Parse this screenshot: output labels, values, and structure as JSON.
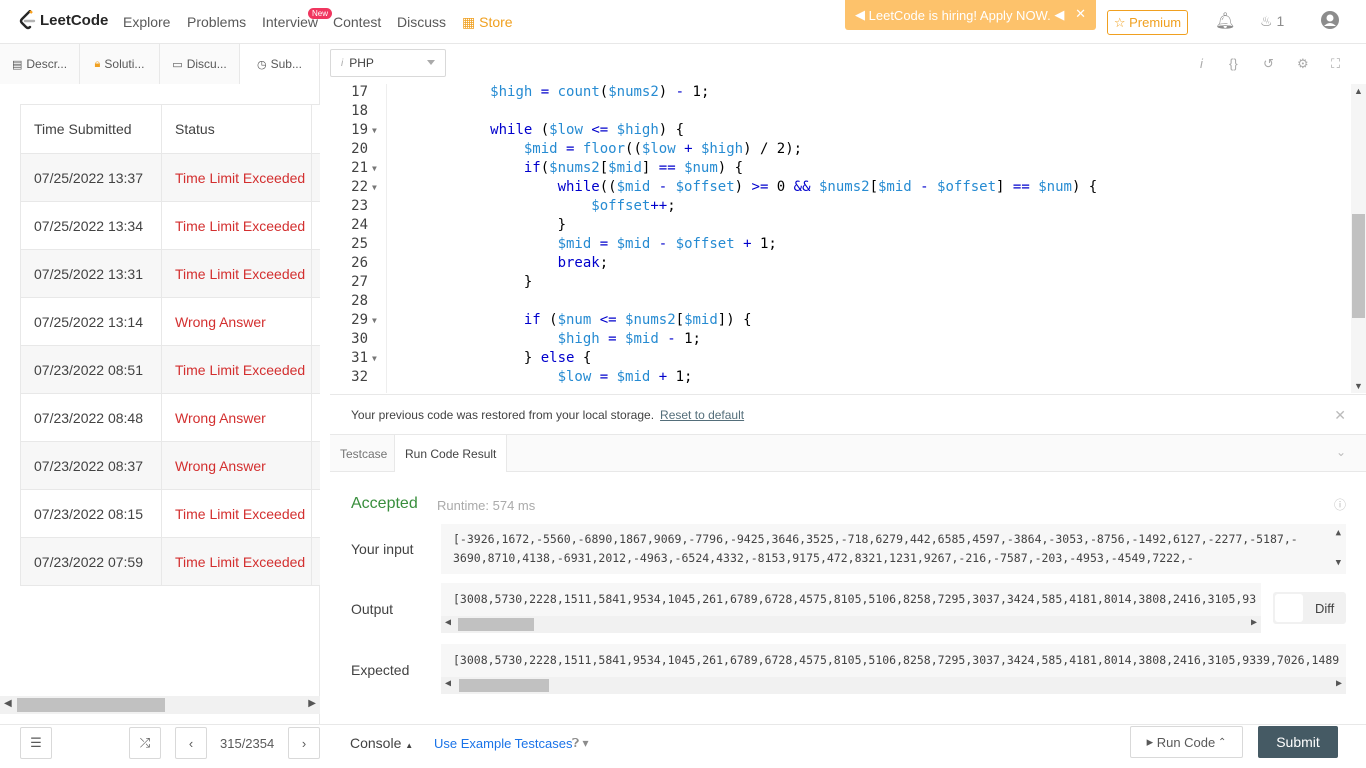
{
  "nav": {
    "logo": "LeetCode",
    "links": [
      "Explore",
      "Problems",
      "Interview",
      "Contest",
      "Discuss",
      "Store"
    ],
    "new_badge": "New",
    "hiring": "LeetCode is hiring! Apply NOW.",
    "premium": "Premium",
    "coins": "1"
  },
  "left": {
    "tabs": [
      "Descr...",
      "Soluti...",
      "Discu...",
      "Sub..."
    ],
    "table_headers": [
      "Time Submitted",
      "Status"
    ],
    "rows": [
      {
        "time": "07/25/2022 13:37",
        "status": "Time Limit Exceeded"
      },
      {
        "time": "07/25/2022 13:34",
        "status": "Time Limit Exceeded"
      },
      {
        "time": "07/25/2022 13:31",
        "status": "Time Limit Exceeded"
      },
      {
        "time": "07/25/2022 13:14",
        "status": "Wrong Answer"
      },
      {
        "time": "07/23/2022 08:51",
        "status": "Time Limit Exceeded"
      },
      {
        "time": "07/23/2022 08:48",
        "status": "Wrong Answer"
      },
      {
        "time": "07/23/2022 08:37",
        "status": "Wrong Answer"
      },
      {
        "time": "07/23/2022 08:15",
        "status": "Time Limit Exceeded"
      },
      {
        "time": "07/23/2022 07:59",
        "status": "Time Limit Exceeded"
      }
    ]
  },
  "editor": {
    "language": "PHP",
    "lines": [
      {
        "n": "17",
        "fold": false,
        "t": "            $high = count($nums2) - 1;"
      },
      {
        "n": "18",
        "fold": false,
        "t": ""
      },
      {
        "n": "19",
        "fold": true,
        "t": "            while ($low <= $high) {"
      },
      {
        "n": "20",
        "fold": false,
        "t": "                $mid = floor(($low + $high) / 2);"
      },
      {
        "n": "21",
        "fold": true,
        "t": "                if($nums2[$mid] == $num) {"
      },
      {
        "n": "22",
        "fold": true,
        "t": "                    while(($mid - $offset) >= 0 && $nums2[$mid - $offset] == $num) {"
      },
      {
        "n": "23",
        "fold": false,
        "t": "                        $offset++;"
      },
      {
        "n": "24",
        "fold": false,
        "t": "                    }"
      },
      {
        "n": "25",
        "fold": false,
        "t": "                    $mid = $mid - $offset + 1;"
      },
      {
        "n": "26",
        "fold": false,
        "t": "                    break;"
      },
      {
        "n": "27",
        "fold": false,
        "t": "                }"
      },
      {
        "n": "28",
        "fold": false,
        "t": ""
      },
      {
        "n": "29",
        "fold": true,
        "t": "                if ($num <= $nums2[$mid]) {"
      },
      {
        "n": "30",
        "fold": false,
        "t": "                    $high = $mid - 1;"
      },
      {
        "n": "31",
        "fold": true,
        "t": "                } else {"
      },
      {
        "n": "32",
        "fold": false,
        "t": "                    $low = $mid + 1;"
      }
    ]
  },
  "restore": {
    "text": "Your previous code was restored from your local storage.",
    "link": "Reset to default"
  },
  "result_tabs": [
    "Testcase",
    "Run Code Result"
  ],
  "result": {
    "status": "Accepted",
    "runtime": "Runtime: 574 ms",
    "input_label": "Your input",
    "input_line1": "[-3926,1672,-5560,-6890,1867,9069,-7796,-9425,3646,3525,-718,6279,442,6585,4597,-3864,-3053,-8756,-1492,6127,-2277,-5187,-",
    "input_line2": "3690,8710,4138,-6931,2012,-4963,-6524,4332,-8153,9175,472,8321,1231,9267,-216,-7587,-203,-4953,-4549,7222,-",
    "output_label": "Output",
    "output": "[3008,5730,2228,1511,5841,9534,1045,261,6789,6728,4575,8105,5106,8258,7295,3037,3424,585,4181,8014,3808,2416,3105,93",
    "expected_label": "Expected",
    "expected": "[3008,5730,2228,1511,5841,9534,1045,261,6789,6728,4575,8105,5106,8258,7295,3037,3424,585,4181,8014,3808,2416,3105,9339,7026,1489",
    "diff": "Diff"
  },
  "bottom": {
    "pager": "315/2354",
    "console": "Console",
    "example": "Use Example Testcases",
    "run": "Run Code",
    "submit": "Submit"
  },
  "colors": {
    "accent": "#f0a020",
    "error": "#d32f2f",
    "success": "#388e3c",
    "submit_bg": "#455a64"
  }
}
